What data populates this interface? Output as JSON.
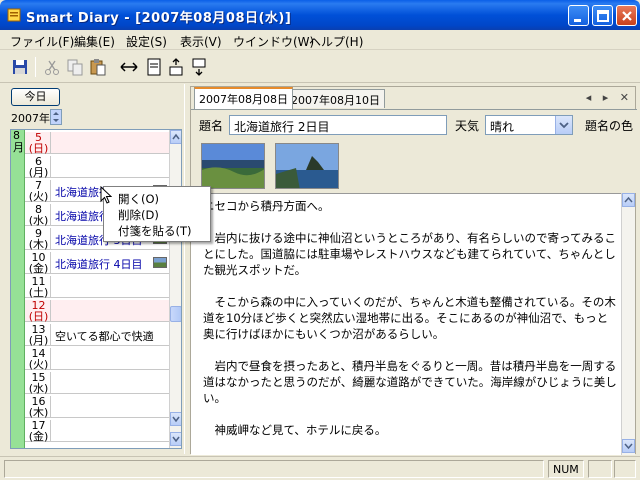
{
  "window": {
    "title": "Smart Diary - [2007年08月08日(水)]"
  },
  "menu": [
    {
      "label": "ファイル(F)"
    },
    {
      "label": "編集(E)"
    },
    {
      "label": "設定(S)"
    },
    {
      "label": "表示(V)"
    },
    {
      "label": "ウインドウ(W)"
    },
    {
      "label": "ヘルプ(H)"
    }
  ],
  "toolbar_icons": [
    "save-icon",
    "cut-icon",
    "copy-icon",
    "paste-icon",
    "arrows-icon",
    "page-icon",
    "insert-above-icon",
    "insert-below-icon"
  ],
  "sidebar": {
    "today_button": "今日",
    "year": "2007年",
    "month": "8月",
    "days": [
      {
        "day": "5",
        "weekday": "(日)",
        "text": "",
        "sunday": true,
        "image": false
      },
      {
        "day": "6",
        "weekday": "(月)",
        "text": "",
        "sunday": false,
        "image": false
      },
      {
        "day": "7",
        "weekday": "(火)",
        "text": "北海道旅行 1日目",
        "sunday": false,
        "image": true
      },
      {
        "day": "8",
        "weekday": "(水)",
        "text": "北海道旅行 2日目",
        "sunday": false,
        "image": true
      },
      {
        "day": "9",
        "weekday": "(木)",
        "text": "北海道旅行 3日目",
        "sunday": false,
        "image": true
      },
      {
        "day": "10",
        "weekday": "(金)",
        "text": "北海道旅行 4日目",
        "sunday": false,
        "image": true
      },
      {
        "day": "11",
        "weekday": "(土)",
        "text": "",
        "sunday": false,
        "image": false
      },
      {
        "day": "12",
        "weekday": "(日)",
        "text": "",
        "sunday": true,
        "image": false
      },
      {
        "day": "13",
        "weekday": "(月)",
        "text": "空いてる都心で快適",
        "sunday": false,
        "image": false
      },
      {
        "day": "14",
        "weekday": "(火)",
        "text": "",
        "sunday": false,
        "image": false
      },
      {
        "day": "15",
        "weekday": "(水)",
        "text": "",
        "sunday": false,
        "image": false
      },
      {
        "day": "16",
        "weekday": "(木)",
        "text": "",
        "sunday": false,
        "image": false
      },
      {
        "day": "17",
        "weekday": "(金)",
        "text": "",
        "sunday": false,
        "image": false
      }
    ]
  },
  "tabs": [
    {
      "label": "2007年08月08日",
      "active": true
    },
    {
      "label": "2007年08月10日",
      "active": false
    }
  ],
  "tab_nav": "◂ ▸ ✕",
  "fields": {
    "title_label": "題名",
    "title_value": "北海道旅行 2日目",
    "weather_label": "天気",
    "weather_value": "晴れ",
    "title_color_label": "題名の色"
  },
  "body_paragraphs": [
    "ニセコから積丹方面へ。",
    "　岩内に抜ける途中に神仙沼というところがあり、有名らしいので寄ってみることにした。国道脇には駐車場やレストハウスなども建てられていて、ちゃんとした観光スポットだ。",
    "　そこから森の中に入っていくのだが、ちゃんと木道も整備されている。その木道を10分ほど歩くと突然広い湿地帯に出る。そこにあるのが神仙沼で、もっと奥に行けばほかにもいくつか沼があるらしい。",
    "　岩内で昼食を摂ったあと、積丹半島をぐるりと一周。昔は積丹半島を一周する道はなかったと思うのだが、綺麗な道路ができていた。海岸線がひじょうに美しい。",
    "　神威岬など見て、ホテルに戻る。"
  ],
  "context_menu": [
    {
      "label": "開く(O)"
    },
    {
      "label": "削除(D)"
    },
    {
      "label": "付箋を貼る(T)"
    }
  ],
  "status": {
    "num": "NUM"
  },
  "colors": {
    "title_bar": "#0050d8",
    "month_column": "#96e196",
    "link_text": "#0000a8",
    "sunday": "#c00000",
    "active_tab_accent": "#e68b2c"
  }
}
